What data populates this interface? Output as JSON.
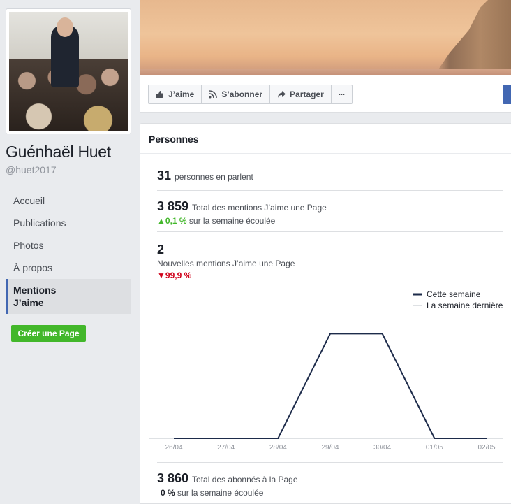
{
  "page": {
    "name": "Guénhaël Huet",
    "handle": "@huet2017"
  },
  "nav": {
    "items": [
      {
        "label": "Accueil"
      },
      {
        "label": "Publications"
      },
      {
        "label": "Photos"
      },
      {
        "label": "À propos"
      },
      {
        "label": "Mentions J’aime",
        "active": true
      }
    ]
  },
  "create_page_label": "Créer une Page",
  "actions": {
    "like": "J’aime",
    "subscribe": "S’abonner",
    "share": "Partager",
    "more": "···"
  },
  "card": {
    "title": "Personnes",
    "talking": {
      "value": "31",
      "label": "personnes en parlent"
    },
    "total_likes": {
      "value": "3 859",
      "label": "Total des mentions J’aime une Page",
      "change": "0,1 %",
      "change_label": "sur la semaine écoulée",
      "direction": "up"
    },
    "new_likes": {
      "value": "2",
      "label": "Nouvelles mentions J’aime une Page",
      "change": "99,9 %",
      "direction": "down"
    },
    "followers": {
      "value": "3 860",
      "label": "Total des abonnés à la Page",
      "change": "0 %",
      "change_label": "sur la semaine écoulée"
    }
  },
  "colors": {
    "accent": "#4267b2",
    "green": "#42b72a",
    "red": "#d0021b",
    "line": "#1d2b4a"
  },
  "chart_data": {
    "type": "line",
    "categories": [
      "26/04",
      "27/04",
      "28/04",
      "29/04",
      "30/04",
      "01/05",
      "02/05"
    ],
    "series": [
      {
        "name": "Cette semaine",
        "values": [
          0,
          0,
          0,
          2,
          2,
          0,
          0
        ]
      },
      {
        "name": "La semaine dernière",
        "values": [
          0,
          0,
          0,
          0,
          0,
          0,
          0
        ]
      }
    ],
    "ylim": [
      0,
      2.3
    ],
    "legend": "top-right"
  }
}
